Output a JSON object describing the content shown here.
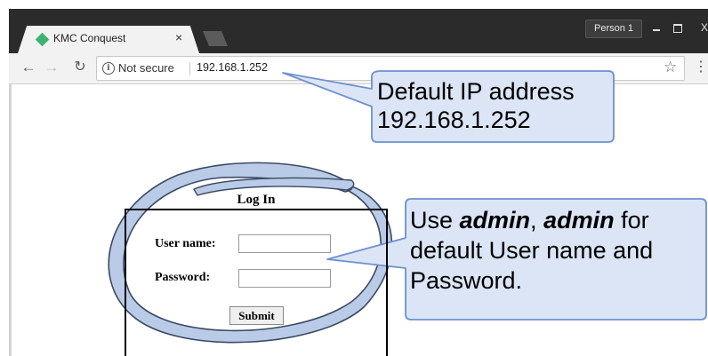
{
  "browser": {
    "profile_label": "Person 1",
    "tab": {
      "title": "KMC Conquest",
      "close": "×"
    },
    "nav": {
      "back": "←",
      "forward": "→",
      "reload": "↻"
    },
    "omnibox": {
      "security_text": "Not secure",
      "url": "192.168.1.252"
    },
    "window_controls": {
      "close": "X"
    }
  },
  "login": {
    "title": "Log In",
    "username_label": "User name:",
    "username_value": "",
    "password_label": "Password:",
    "password_value": "",
    "submit_label": "Submit"
  },
  "callouts": {
    "ip_line1": "Default IP address",
    "ip_line2": "192.168.1.252",
    "creds_prefix": "Use ",
    "creds_user": "admin",
    "creds_sep": ", ",
    "creds_pass": "admin",
    "creds_rest": " for default User name and Password."
  },
  "colors": {
    "callout_fill": "#dbe5f5",
    "callout_border": "#6f8fd0",
    "oval_fill": "#b9cbe6",
    "oval_stroke": "#3a4a63"
  }
}
